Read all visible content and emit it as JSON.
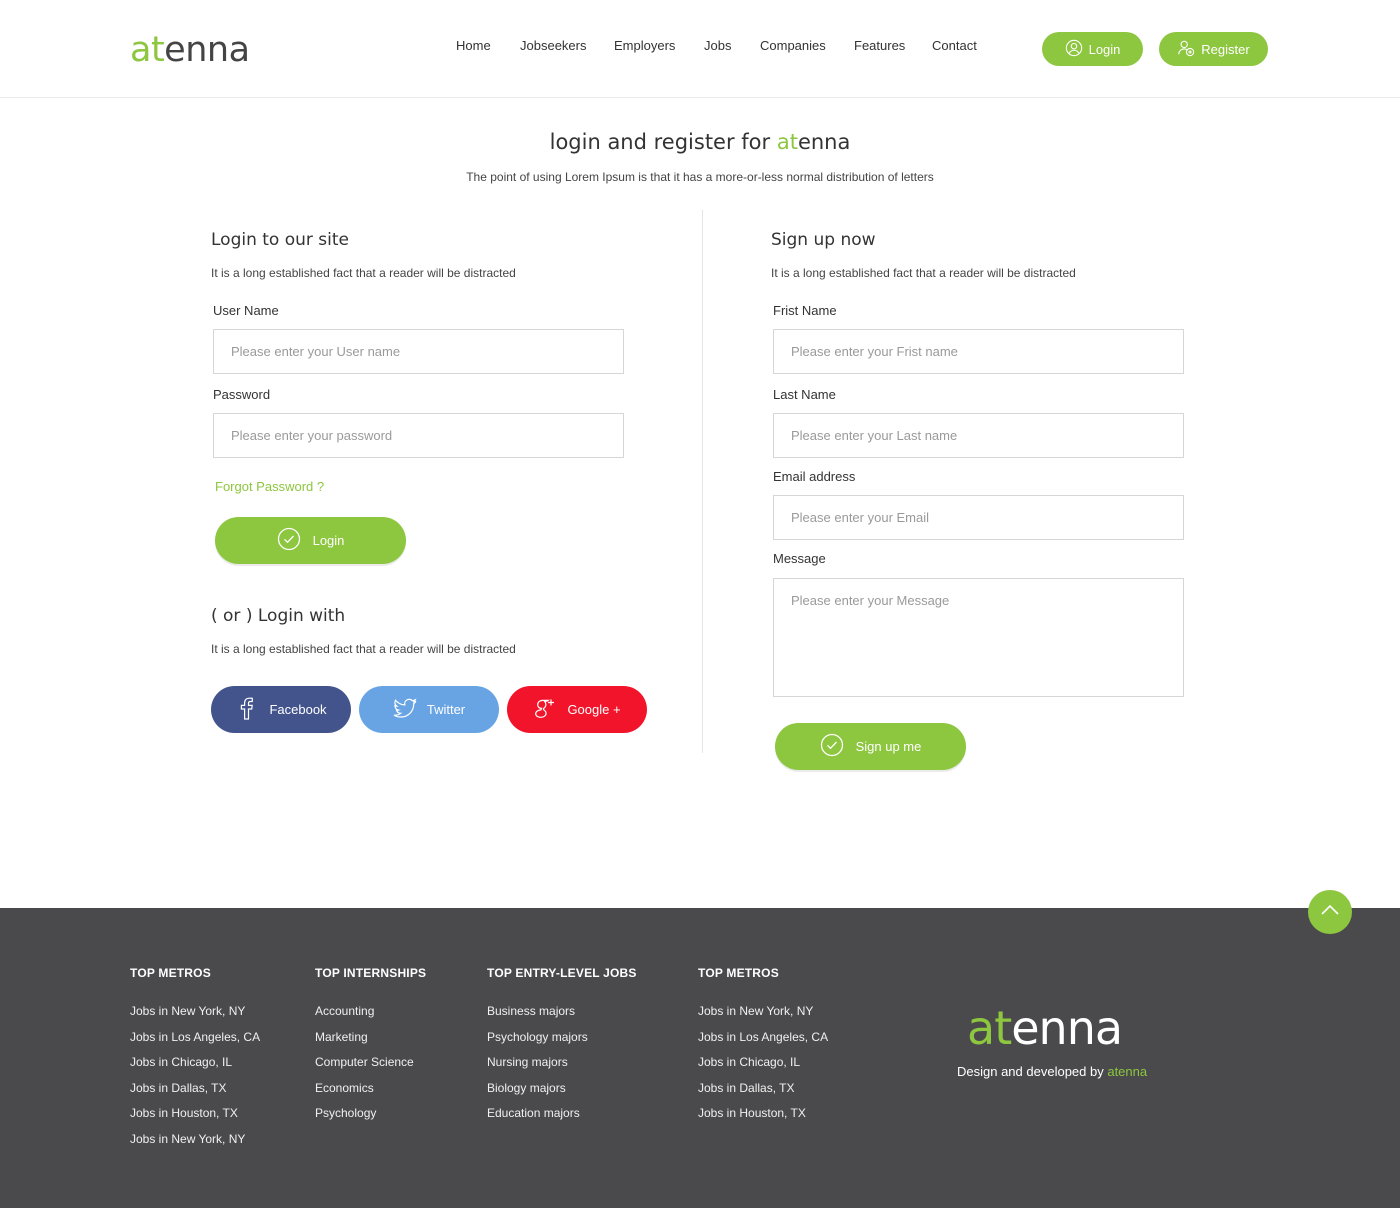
{
  "brand": {
    "logo_prefix": "at",
    "logo_suffix": "enna",
    "accent_color": "#8dc63f"
  },
  "nav": {
    "items": [
      "Home",
      "Jobseekers",
      "Employers",
      "Jobs",
      "Companies",
      "Features",
      "Contact"
    ],
    "login_label": "Login",
    "register_label": "Register"
  },
  "hero": {
    "title_prefix": "login and register for ",
    "title_accent": "at",
    "title_suffix": "enna",
    "subtitle": "The point of using Lorem Ipsum is that it has a more-or-less normal distribution of letters"
  },
  "login": {
    "heading": "Login to our site",
    "desc": "It is a long established fact that a reader will be distracted",
    "username_label": "User Name",
    "username_placeholder": "Please enter your User name",
    "password_label": "Password",
    "password_placeholder": "Please enter your password",
    "forgot": "Forgot Password ?",
    "button": "Login"
  },
  "social": {
    "heading": "( or ) Login with",
    "desc": "It is a long established fact that a reader will be distracted",
    "facebook": "Facebook",
    "twitter": "Twitter",
    "google": "Google +",
    "colors": {
      "facebook": "#43548d",
      "twitter": "#68a4e3",
      "google": "#f2142a"
    }
  },
  "signup": {
    "heading": "Sign up now",
    "desc": "It is a long established fact that a reader will be distracted",
    "first_label": "Frist Name",
    "first_placeholder": "Please enter your Frist name",
    "last_label": "Last Name",
    "last_placeholder": "Please enter your Last name",
    "email_label": "Email address",
    "email_placeholder": "Please enter your Email",
    "message_label": "Message",
    "message_placeholder": "Please enter your Message",
    "button": "Sign up me"
  },
  "footer": {
    "columns": [
      {
        "heading": "TOP METROS",
        "items": [
          "Jobs in New York, NY",
          "Jobs in Los Angeles, CA",
          "Jobs in Chicago, IL",
          "Jobs in Dallas, TX",
          "Jobs in Houston, TX",
          "Jobs in New York, NY"
        ]
      },
      {
        "heading": "TOP INTERNSHIPS",
        "items": [
          "Accounting",
          "Marketing",
          "Computer Science",
          "Economics",
          "Psychology"
        ]
      },
      {
        "heading": "TOP ENTRY-LEVEL JOBS",
        "items": [
          "Business majors",
          "Psychology majors",
          "Nursing majors",
          "Biology majors",
          "Education majors"
        ]
      },
      {
        "heading": "TOP METROS",
        "items": [
          "Jobs in New York, NY",
          "Jobs in Los Angeles, CA",
          "Jobs in Chicago, IL",
          "Jobs in Dallas, TX",
          "Jobs in Houston, TX"
        ]
      }
    ],
    "logo_prefix": "at",
    "logo_suffix": "enna",
    "credit_text": "Design and developed by ",
    "credit_brand": "atenna",
    "background": "#4a4a4c"
  }
}
